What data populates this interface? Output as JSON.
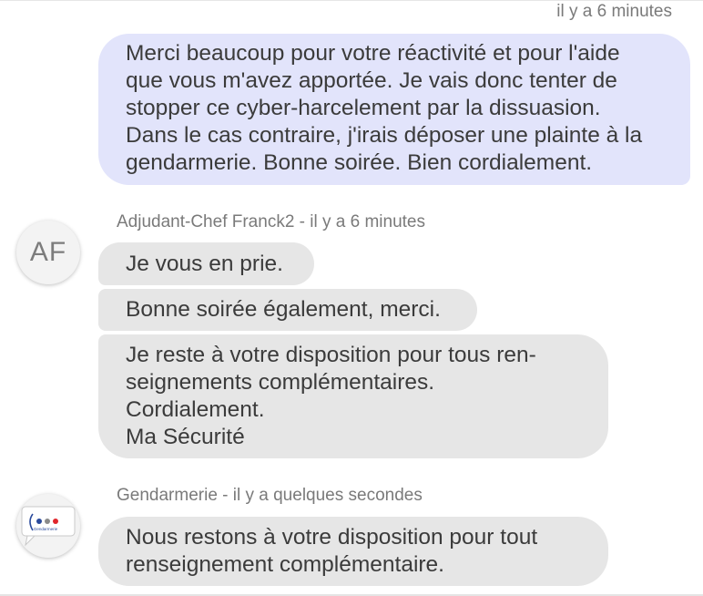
{
  "messages": {
    "own": {
      "timestamp": "il y a 6 minutes",
      "text": "Merci beaucoup pour votre réactivité et pour l'aide\nque vous m'avez apportée. Je vais donc tenter de\nstopper ce cyber-harcelement par la dissuasion.\nDans le cas contraire, j'irais déposer une plainte à la\ngendarmerie. Bonne soirée. Bien cordialement."
    },
    "franck": {
      "avatar_initials": "AF",
      "sender_line": "Adjudant-Chef Franck2 - il y a 6 minutes",
      "bubbles": [
        "Je vous en prie.",
        "Bonne soirée également, merci.",
        "Je reste à votre disposition pour tous ren-\nseignements complémentaires.\nCordialement.\nMa Sécurité"
      ]
    },
    "gendarmerie": {
      "avatar_logo_text": "Gendarmerie",
      "sender_line": "Gendarmerie - il y a quelques secondes",
      "bubbles": [
        "Nous restons à votre disposition pour tout\nrenseignement complémentaire."
      ]
    }
  },
  "colors": {
    "own_bubble": "#e2e4fb",
    "other_bubble": "#e6e6e6",
    "meta_text": "#7a7a7a",
    "logo_dot_blue": "#2a4a9c",
    "logo_dot_red": "#e0262c"
  }
}
